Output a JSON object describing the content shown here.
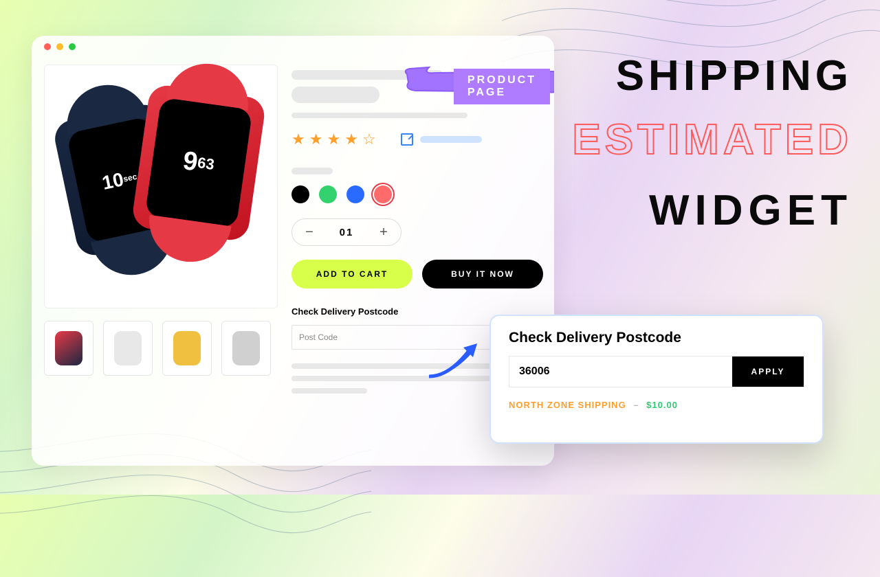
{
  "headline": {
    "w1": "SHIPPING",
    "w2": "ESTIMATED",
    "w3": "WIDGET"
  },
  "badge": {
    "label": "PRODUCT PAGE"
  },
  "product": {
    "rating": {
      "full": 4,
      "empty": 1
    },
    "swatches": [
      {
        "name": "black",
        "selected": false
      },
      {
        "name": "green",
        "selected": false
      },
      {
        "name": "blue",
        "selected": false
      },
      {
        "name": "coral",
        "selected": true
      }
    ],
    "quantity": {
      "value": "01"
    },
    "cta": {
      "add": "ADD TO CART",
      "buy": "BUY IT NOW"
    },
    "delivery_widget": {
      "label": "Check Delivery Postcode",
      "placeholder": "Post Code"
    }
  },
  "popup": {
    "label": "Check Delivery Postcode",
    "value": "36006",
    "apply": "APPLY",
    "result": {
      "zone": "NORTH ZONE SHIPPING",
      "dash": "–",
      "price": "$10.00"
    }
  }
}
